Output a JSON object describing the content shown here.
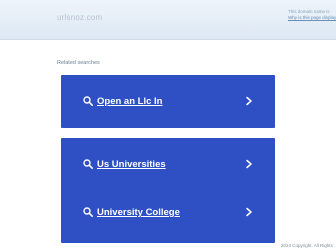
{
  "header": {
    "domain": "urlsnoz.com",
    "notice_line1": "This domain name is",
    "notice_line2": "Why is this page displayed?"
  },
  "related_searches": {
    "heading": "Related searches",
    "items": [
      {
        "label": "Open an Llc In"
      },
      {
        "label": "Us Universities"
      },
      {
        "label": "University College"
      }
    ]
  },
  "footer": {
    "text": "2024 Copyright. All Rights"
  },
  "colors": {
    "button_bg": "#2f50c4",
    "header_bg": "#e6eef7"
  },
  "icons": {
    "search": "search-icon",
    "chevron": "chevron-right-icon"
  }
}
